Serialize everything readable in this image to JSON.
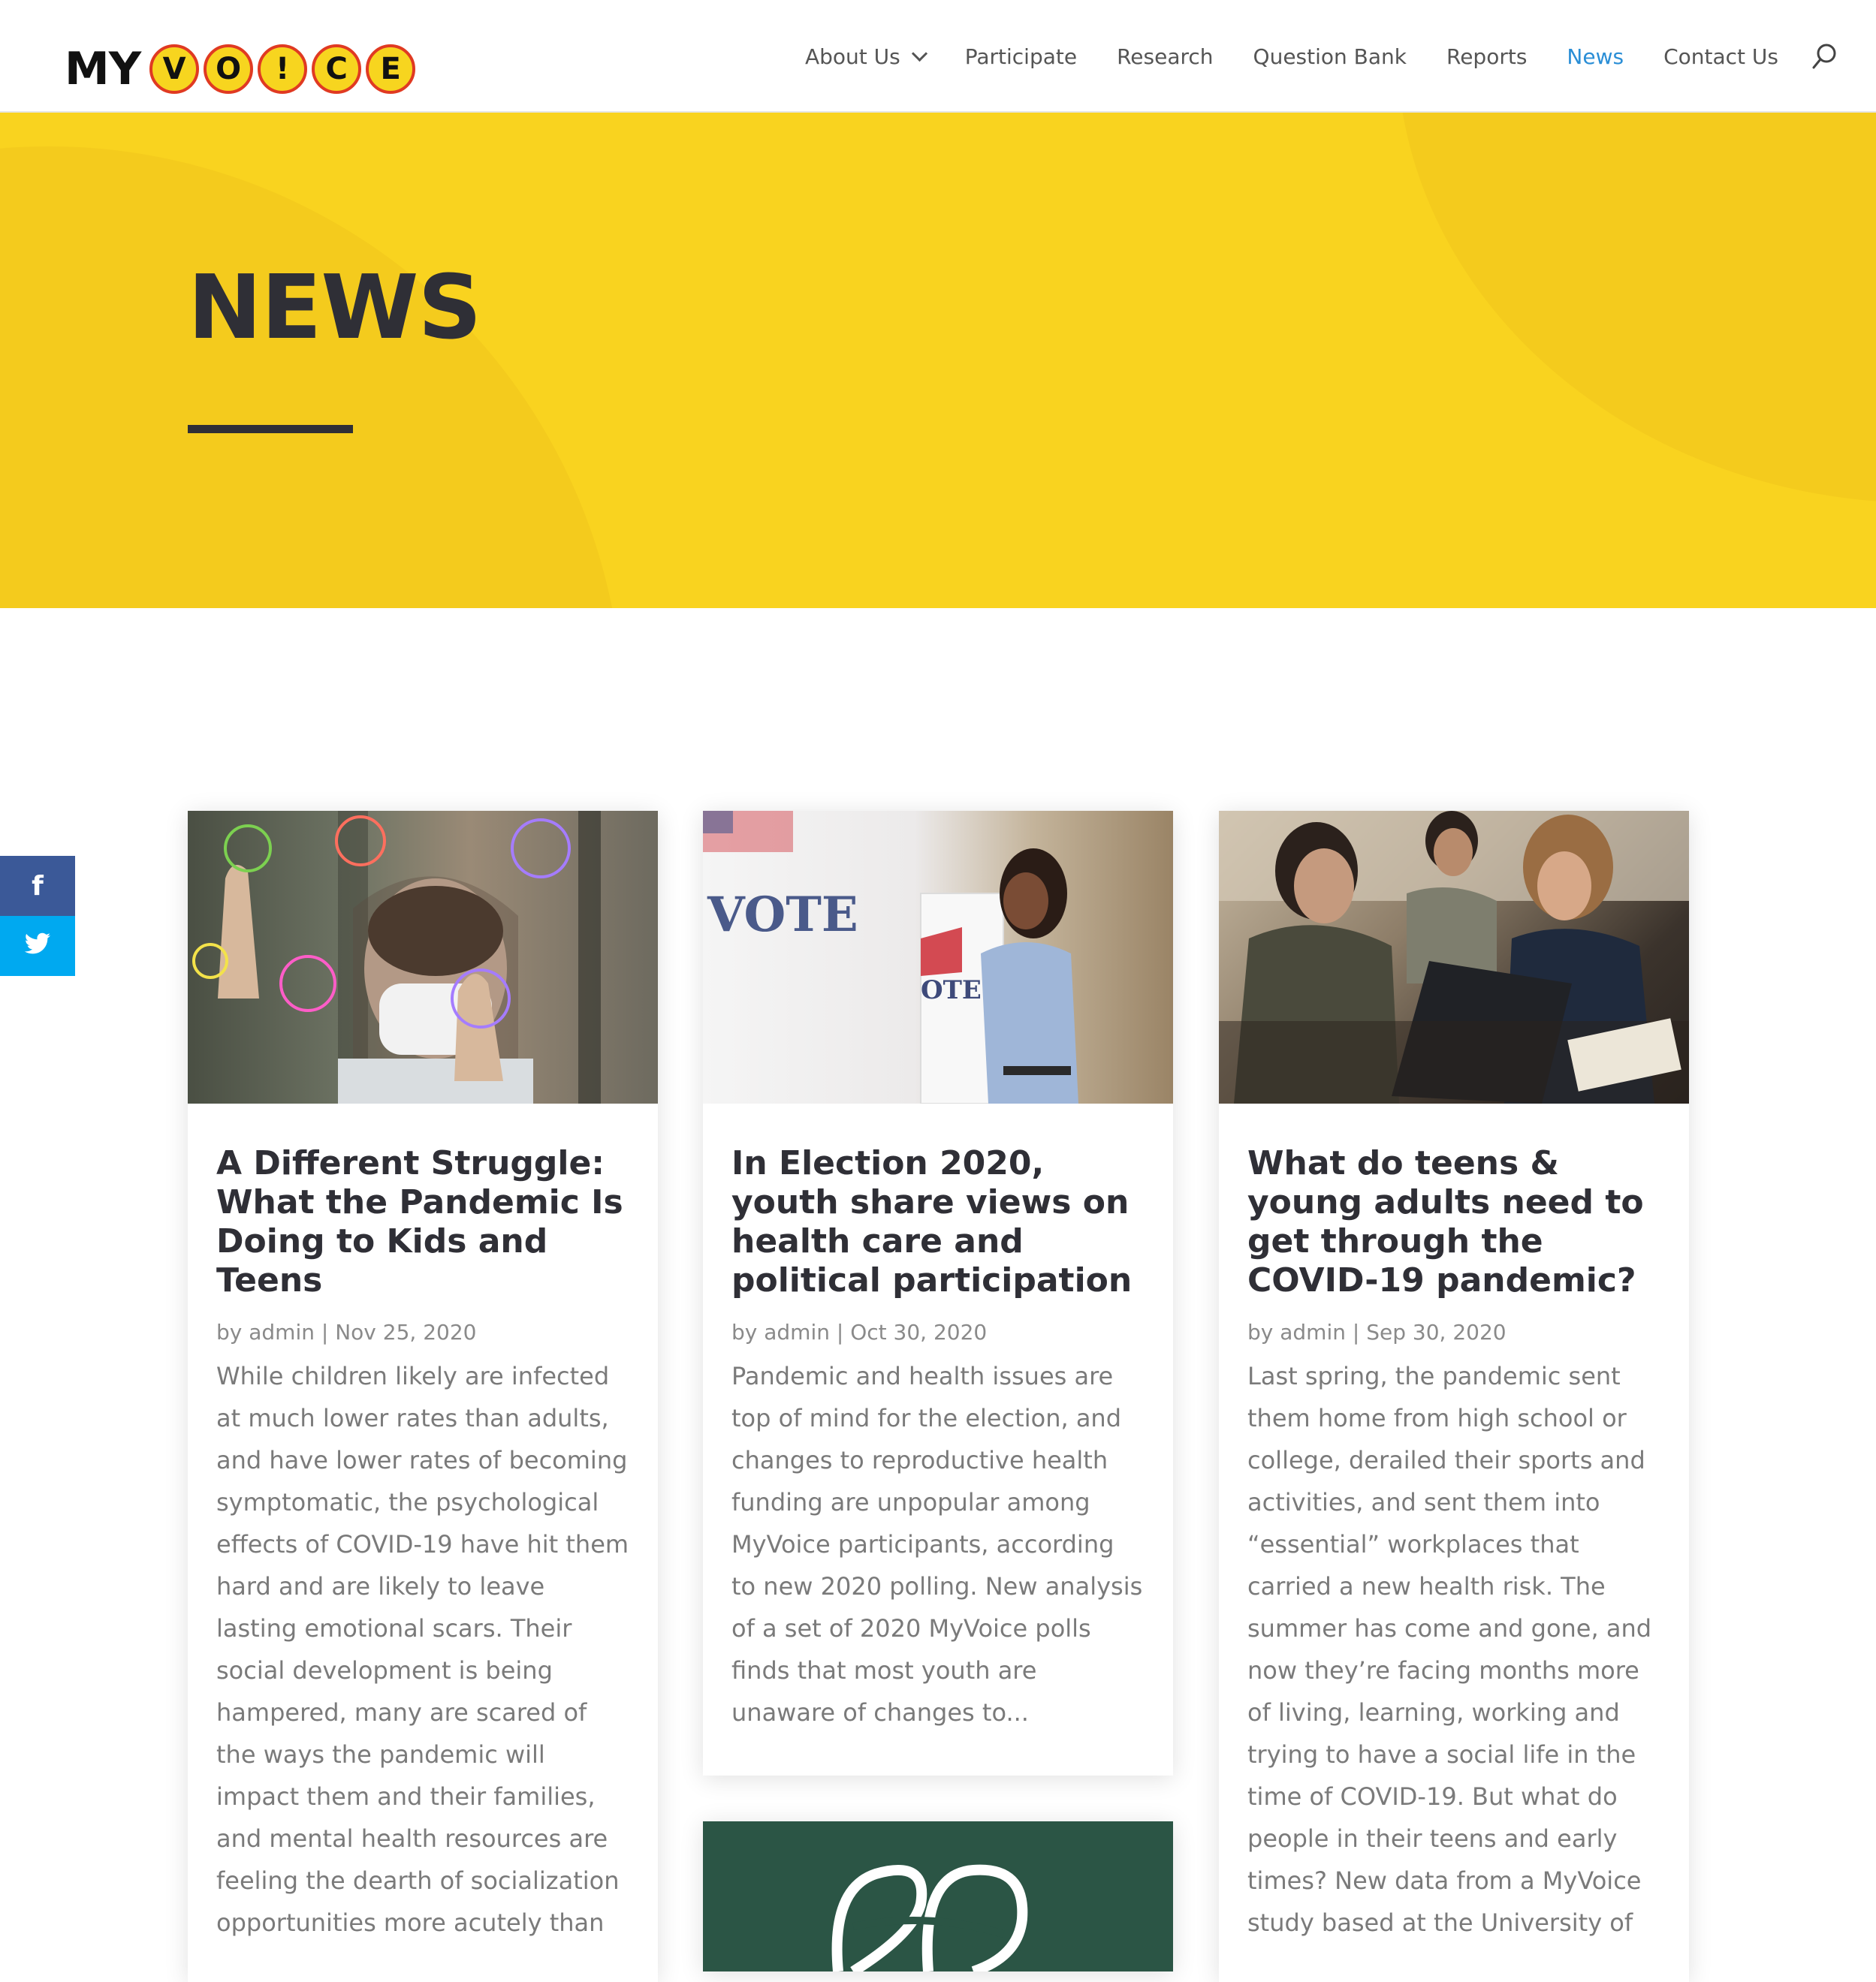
{
  "header": {
    "logo_text": "MY",
    "logo_letters": [
      "V",
      "O",
      "!",
      "C",
      "E"
    ],
    "nav": [
      {
        "label": "About Us",
        "has_dropdown": true
      },
      {
        "label": "Participate"
      },
      {
        "label": "Research"
      },
      {
        "label": "Question Bank"
      },
      {
        "label": "Reports"
      },
      {
        "label": "News",
        "active": true
      },
      {
        "label": "Contact Us"
      }
    ],
    "search_icon": "search-icon"
  },
  "hero": {
    "title": "NEWS",
    "background_color": "#f9d31f"
  },
  "share": {
    "facebook_glyph": "f",
    "twitter_glyph": "t"
  },
  "posts": [
    {
      "title": "A Different Struggle: What the Pandemic Is Doing to Kids and Teens",
      "meta": "by admin | Nov 25, 2020",
      "excerpt": "While children likely are infected at much lower rates than adults, and have lower rates of becoming symptomatic, the psychological effects of COVID-19 have hit them hard and are likely to leave lasting emotional scars. Their social development is being hampered, many are scared of the ways the pandemic will impact them and their families, and mental health resources are feeling the dearth of socialization opportunities more acutely than"
    },
    {
      "title": "In Election 2020, youth share views on health care and political participation",
      "meta": "by admin | Oct 30, 2020",
      "excerpt": "Pandemic and health issues are top of mind for the election, and changes to reproductive health funding are unpopular among MyVoice participants, according to new 2020 polling. New analysis of a set of 2020 MyVoice polls finds that most youth are unaware of changes to...",
      "image_text": [
        "VOTE",
        "OTE"
      ]
    },
    {
      "title": "What do teens & young adults need to get through the COVID-19 pandemic?",
      "meta": "by admin | Sep 30, 2020",
      "excerpt": "Last spring, the pandemic sent them home from high school or college, derailed their sports and activities, and sent them into “essential” workplaces that carried a new health risk. The summer has come and gone, and now they’re facing months more of living, learning, working and trying to have a social life in the time of COVID-19. But what do people in their teens and early times? New data from a MyVoice study based at the University of"
    }
  ]
}
